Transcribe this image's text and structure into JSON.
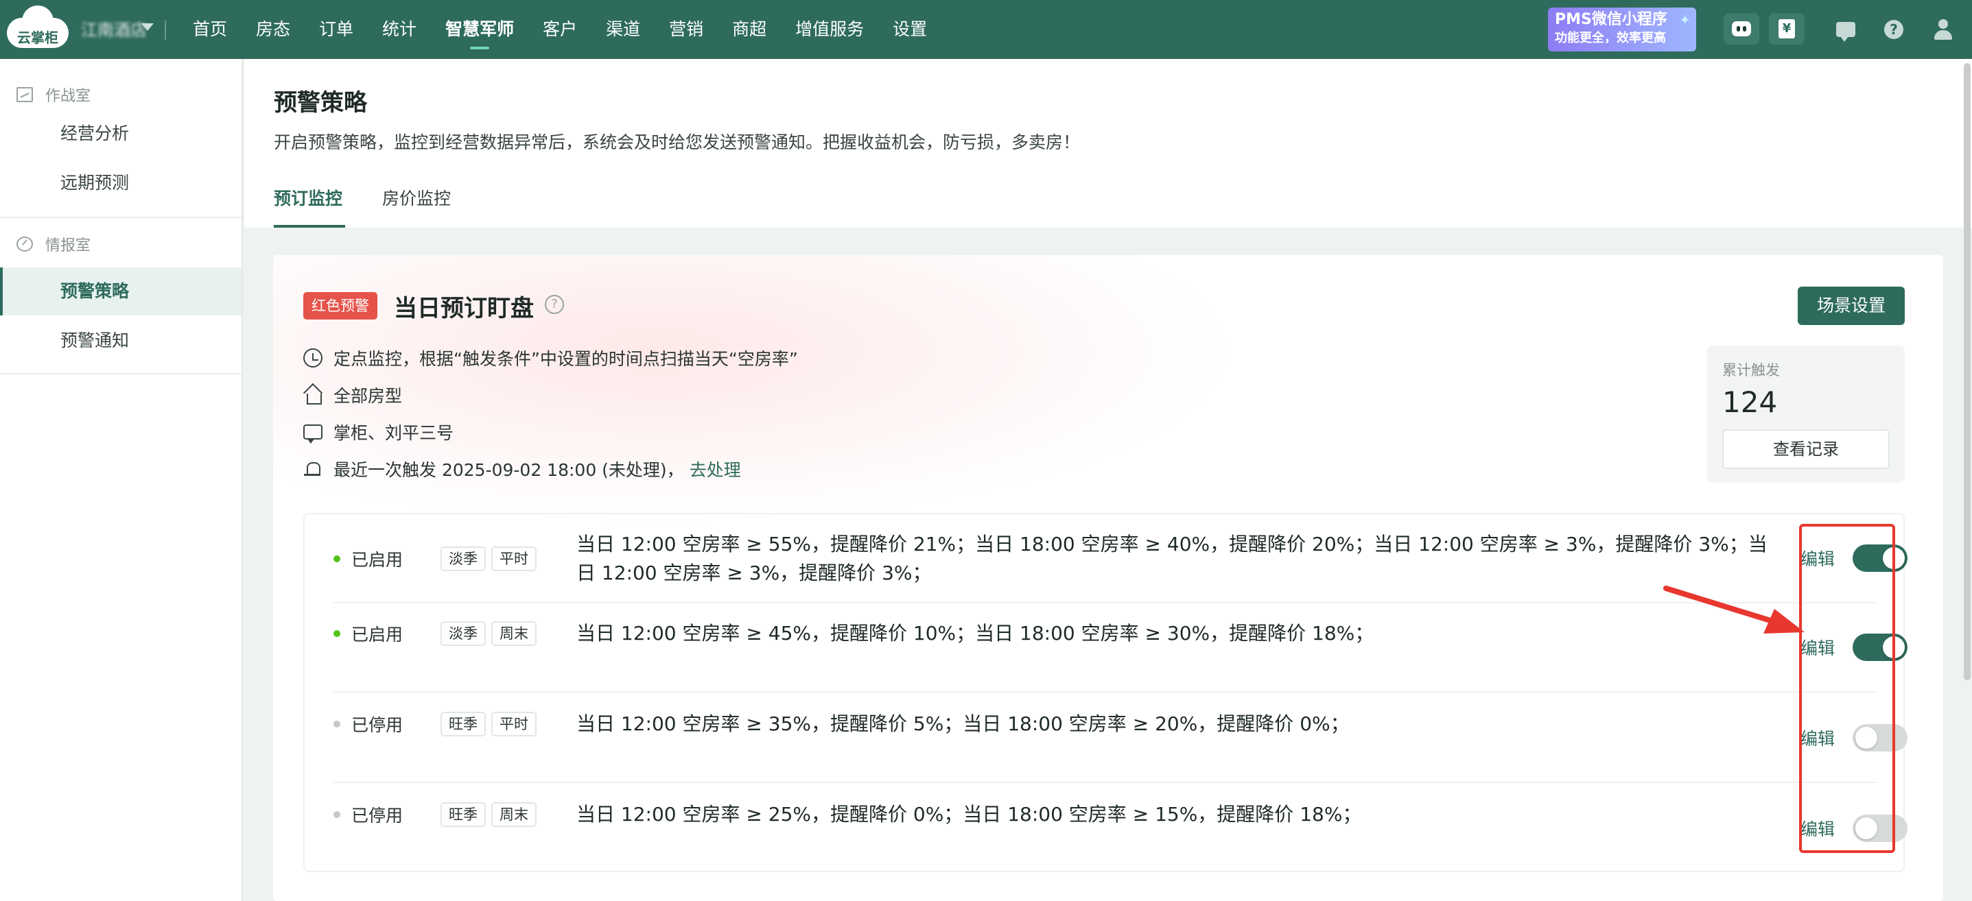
{
  "app": {
    "logo_text": "云掌柜",
    "hotel_name": "江南酒店"
  },
  "nav": {
    "items": [
      "首页",
      "房态",
      "订单",
      "统计",
      "智慧军师",
      "客户",
      "渠道",
      "营销",
      "商超",
      "增值服务",
      "设置"
    ],
    "active": "智慧军师"
  },
  "promo": {
    "line1": "PMS微信小程序",
    "line2": "功能更全，效率更高"
  },
  "sidebar": {
    "group1": "作战室",
    "group1_items": [
      "经营分析",
      "远期预测"
    ],
    "group2": "情报室",
    "group2_items": [
      "预警策略",
      "预警通知"
    ],
    "active": "预警策略"
  },
  "page": {
    "title": "预警策略",
    "description": "开启预警策略，监控到经营数据异常后，系统会及时给您发送预警通知。把握收益机会，防亏损，多卖房！",
    "tabs": [
      "预订监控",
      "房价监控"
    ],
    "active_tab": "预订监控"
  },
  "card": {
    "tag": "红色预警",
    "title": "当日预订盯盘",
    "scene_button": "场景设置",
    "info": {
      "monitor": "定点监控，根据“触发条件”中设置的时间点扫描当天“空房率”",
      "room_types": "全部房型",
      "recipients": "掌柜、刘平三号",
      "last_trigger": "最近一次触发 2025-09-02 18:00 (未处理)，",
      "handle_link": "去处理"
    },
    "stats": {
      "label": "累计触发",
      "value": "124",
      "button": "查看记录"
    },
    "edit_label": "编辑",
    "rules": [
      {
        "status": "已启用",
        "enabled": true,
        "tags": [
          "淡季",
          "平时"
        ],
        "condition": "当日 12:00 空房率 ≥ 55%，提醒降价 21%；当日 18:00 空房率 ≥ 40%，提醒降价 20%；当日 12:00 空房率 ≥ 3%，提醒降价 3%；当日 12:00 空房率 ≥ 3%，提醒降价 3%；"
      },
      {
        "status": "已启用",
        "enabled": true,
        "tags": [
          "淡季",
          "周末"
        ],
        "condition": "当日 12:00 空房率 ≥ 45%，提醒降价 10%；当日 18:00 空房率 ≥ 30%，提醒降价 18%；"
      },
      {
        "status": "已停用",
        "enabled": false,
        "tags": [
          "旺季",
          "平时"
        ],
        "condition": "当日 12:00 空房率 ≥ 35%，提醒降价 5%；当日 18:00 空房率 ≥ 20%，提醒降价 0%；"
      },
      {
        "status": "已停用",
        "enabled": false,
        "tags": [
          "旺季",
          "周末"
        ],
        "condition": "当日 12:00 空房率 ≥ 25%，提醒降价 0%；当日 18:00 空房率 ≥ 15%，提醒降价 18%；"
      }
    ]
  },
  "colors": {
    "brand": "#2e6b5c",
    "alert_red": "#e5534b",
    "enabled_dot": "#52c41a",
    "annotation": "#e8372e"
  }
}
